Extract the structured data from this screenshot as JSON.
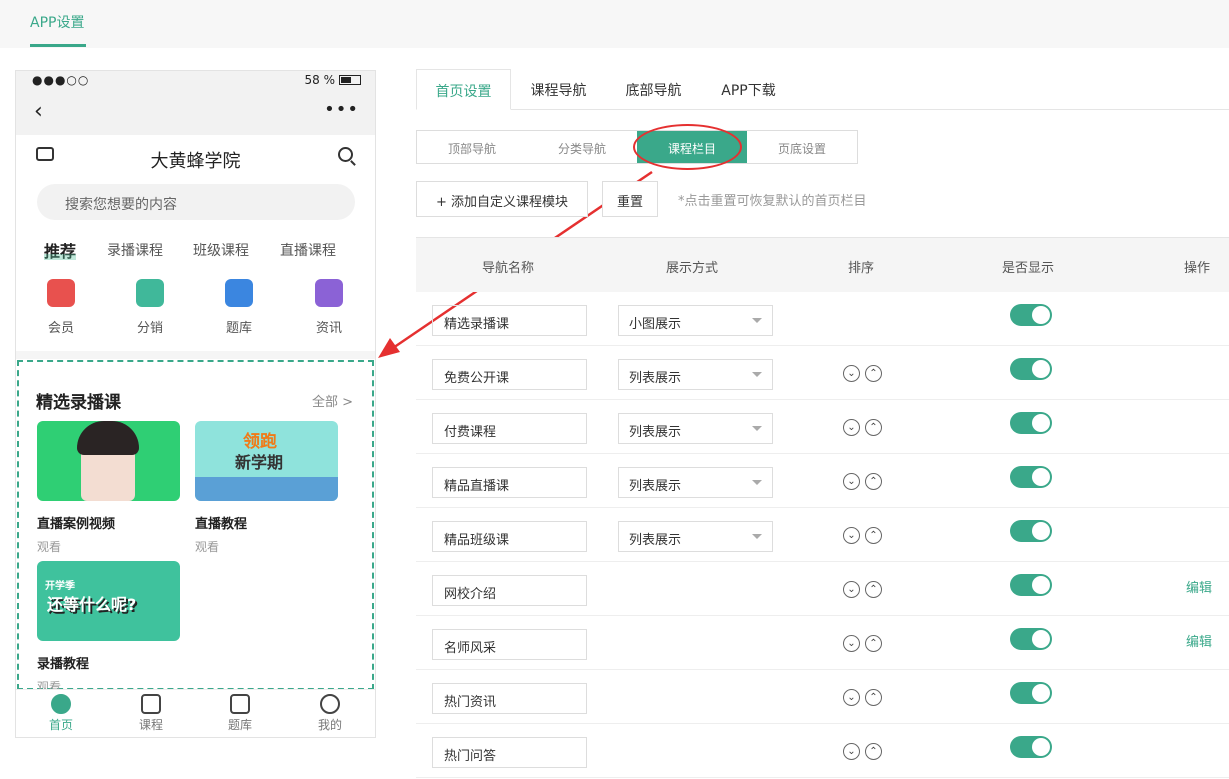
{
  "top": {
    "tab": "APP设置"
  },
  "phone": {
    "status_left": "●●●○○",
    "status_right": "58 %",
    "back": "‹",
    "more": "•••",
    "title": "大黄蜂学院",
    "search_placeholder": "搜索您想要的内容",
    "categories": [
      "推荐",
      "录播课程",
      "班级课程",
      "直播课程"
    ],
    "quick": [
      {
        "label": "会员",
        "color": "#e8514e"
      },
      {
        "label": "分销",
        "color": "#40b89a"
      },
      {
        "label": "题库",
        "color": "#3b86e0"
      },
      {
        "label": "资讯",
        "color": "#8b62d6"
      }
    ],
    "section_title": "精选录播课",
    "section_all": "全部 >",
    "cards": [
      {
        "name": "直播案例视频",
        "sub": "观看"
      },
      {
        "name": "直播教程",
        "sub": "观看",
        "banner_line1": "领跑",
        "banner_line2": "新学期"
      },
      {
        "name": "录播教程",
        "sub": "观看",
        "banner": "还等什么呢?",
        "banner_small": "开学季"
      }
    ],
    "tabbar": [
      "首页",
      "课程",
      "题库",
      "我的"
    ]
  },
  "tabs": [
    "首页设置",
    "课程导航",
    "底部导航",
    "APP下载"
  ],
  "subtabs": [
    "顶部导航",
    "分类导航",
    "课程栏目",
    "页底设置"
  ],
  "actions": {
    "add": "+ 添加自定义课程模块",
    "reset": "重置",
    "hint": "*点击重置可恢复默认的首页栏目"
  },
  "table": {
    "headers": [
      "导航名称",
      "展示方式",
      "排序",
      "是否显示",
      "操作"
    ],
    "rows": [
      {
        "name": "精选录播课",
        "mode": "小图展示",
        "sort": false,
        "edit": ""
      },
      {
        "name": "免费公开课",
        "mode": "列表展示",
        "sort": true,
        "edit": ""
      },
      {
        "name": "付费课程",
        "mode": "列表展示",
        "sort": true,
        "edit": ""
      },
      {
        "name": "精品直播课",
        "mode": "列表展示",
        "sort": true,
        "edit": ""
      },
      {
        "name": "精品班级课",
        "mode": "列表展示",
        "sort": true,
        "edit": ""
      },
      {
        "name": "网校介绍",
        "mode": "",
        "sort": true,
        "edit": "编辑"
      },
      {
        "name": "名师风采",
        "mode": "",
        "sort": true,
        "edit": "编辑"
      },
      {
        "name": "热门资讯",
        "mode": "",
        "sort": true,
        "edit": ""
      },
      {
        "name": "热门问答",
        "mode": "",
        "sort": true,
        "edit": ""
      }
    ]
  }
}
